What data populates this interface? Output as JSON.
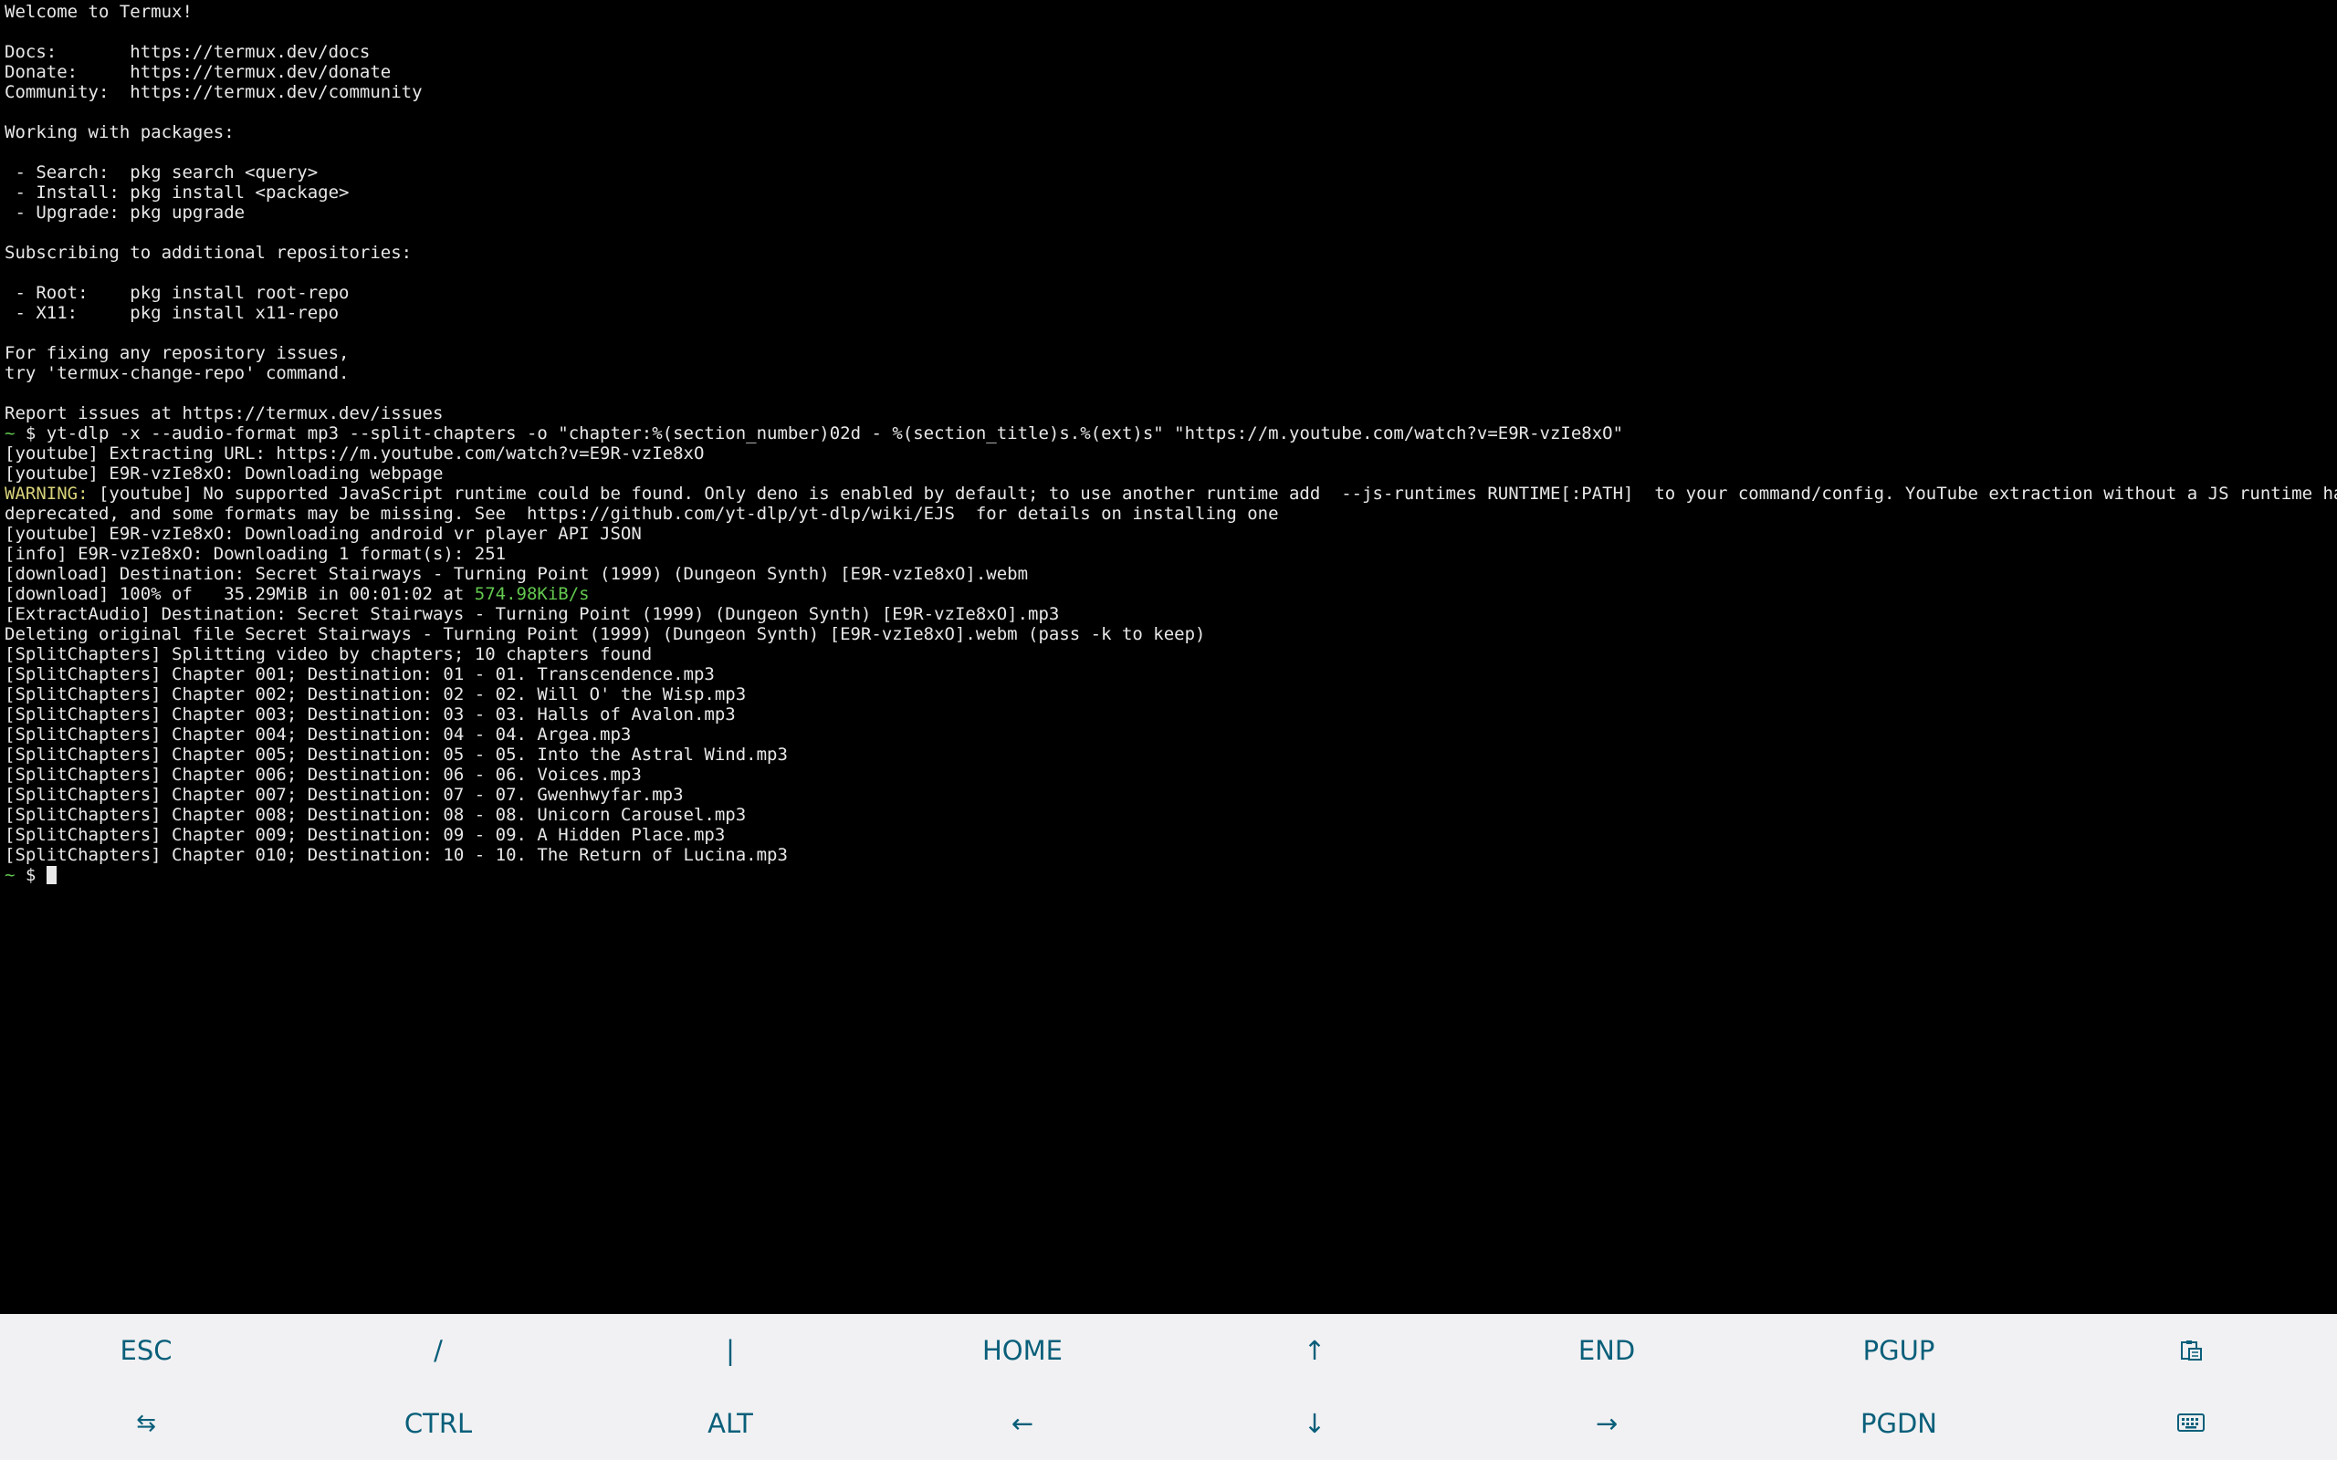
{
  "colors": {
    "background": "#000000",
    "text": "#e8e8e8",
    "prompt": "#63c94f",
    "warning": "#d8d37a",
    "speed": "#63c94f",
    "extra_keys_bg": "#f1f1f3",
    "extra_keys_text": "#0a5f7a"
  },
  "terminal": {
    "lines": [
      [
        {
          "t": "Welcome to Termux!"
        }
      ],
      [],
      [
        {
          "t": "Docs:       https://termux.dev/docs"
        }
      ],
      [
        {
          "t": "Donate:     https://termux.dev/donate"
        }
      ],
      [
        {
          "t": "Community:  https://termux.dev/community"
        }
      ],
      [],
      [
        {
          "t": "Working with packages:"
        }
      ],
      [],
      [
        {
          "t": " - Search:  pkg search <query>"
        }
      ],
      [
        {
          "t": " - Install: pkg install <package>"
        }
      ],
      [
        {
          "t": " - Upgrade: pkg upgrade"
        }
      ],
      [],
      [
        {
          "t": "Subscribing to additional repositories:"
        }
      ],
      [],
      [
        {
          "t": " - Root:    pkg install root-repo"
        }
      ],
      [
        {
          "t": " - X11:     pkg install x11-repo"
        }
      ],
      [],
      [
        {
          "t": "For fixing any repository issues,"
        }
      ],
      [
        {
          "t": "try 'termux-change-repo' command."
        }
      ],
      [],
      [
        {
          "t": "Report issues at https://termux.dev/issues"
        }
      ],
      [
        {
          "t": "~",
          "c": "green"
        },
        {
          "t": " $ yt-dlp -x --audio-format mp3 --split-chapters -o \"chapter:%(section_number)02d - %(section_title)s.%(ext)s\" \"https://m.youtube.com/watch?v=E9R-vzIe8xO\""
        }
      ],
      [
        {
          "t": "[youtube] Extracting URL: https://m.youtube.com/watch?v=E9R-vzIe8xO"
        }
      ],
      [
        {
          "t": "[youtube] E9R-vzIe8xO: Downloading webpage"
        }
      ],
      [
        {
          "t": "WARNING:",
          "c": "yellow"
        },
        {
          "t": " [youtube] No supported JavaScript runtime could be found. Only deno is enabled by default; to use another runtime add  --js-runtimes RUNTIME[:PATH]  to your command/config. YouTube extraction without a JS runtime has been"
        }
      ],
      [
        {
          "t": "deprecated, and some formats may be missing. See  https://github.com/yt-dlp/yt-dlp/wiki/EJS  for details on installing one"
        }
      ],
      [
        {
          "t": "[youtube] E9R-vzIe8xO: Downloading android vr player API JSON"
        }
      ],
      [
        {
          "t": "[info] E9R-vzIe8xO: Downloading 1 format(s): 251"
        }
      ],
      [
        {
          "t": "[download] Destination: Secret Stairways - Turning Point (1999) (Dungeon Synth) [E9R-vzIe8xO].webm"
        }
      ],
      [
        {
          "t": "[download] 100% of   35.29MiB in 00:01:02 at "
        },
        {
          "t": "574.98KiB/s",
          "c": "green"
        }
      ],
      [
        {
          "t": "[ExtractAudio] Destination: Secret Stairways - Turning Point (1999) (Dungeon Synth) [E9R-vzIe8xO].mp3"
        }
      ],
      [
        {
          "t": "Deleting original file Secret Stairways - Turning Point (1999) (Dungeon Synth) [E9R-vzIe8xO].webm (pass -k to keep)"
        }
      ],
      [
        {
          "t": "[SplitChapters] Splitting video by chapters; 10 chapters found"
        }
      ],
      [
        {
          "t": "[SplitChapters] Chapter 001; Destination: 01 - 01. Transcendence.mp3"
        }
      ],
      [
        {
          "t": "[SplitChapters] Chapter 002; Destination: 02 - 02. Will O' the Wisp.mp3"
        }
      ],
      [
        {
          "t": "[SplitChapters] Chapter 003; Destination: 03 - 03. Halls of Avalon.mp3"
        }
      ],
      [
        {
          "t": "[SplitChapters] Chapter 004; Destination: 04 - 04. Argea.mp3"
        }
      ],
      [
        {
          "t": "[SplitChapters] Chapter 005; Destination: 05 - 05. Into the Astral Wind.mp3"
        }
      ],
      [
        {
          "t": "[SplitChapters] Chapter 006; Destination: 06 - 06. Voices.mp3"
        }
      ],
      [
        {
          "t": "[SplitChapters] Chapter 007; Destination: 07 - 07. Gwenhwyfar.mp3"
        }
      ],
      [
        {
          "t": "[SplitChapters] Chapter 008; Destination: 08 - 08. Unicorn Carousel.mp3"
        }
      ],
      [
        {
          "t": "[SplitChapters] Chapter 009; Destination: 09 - 09. A Hidden Place.mp3"
        }
      ],
      [
        {
          "t": "[SplitChapters] Chapter 010; Destination: 10 - 10. The Return of Lucina.mp3"
        }
      ]
    ],
    "prompt": {
      "tilde": "~",
      "symbol": " $ "
    }
  },
  "extra_keys": {
    "row1": [
      {
        "label": "ESC",
        "name": "esc-key"
      },
      {
        "label": "/",
        "name": "slash-key"
      },
      {
        "label": "|",
        "name": "pipe-key"
      },
      {
        "label": "HOME",
        "name": "home-key"
      },
      {
        "label": "↑",
        "name": "up-arrow-key"
      },
      {
        "label": "END",
        "name": "end-key"
      },
      {
        "label": "PGUP",
        "name": "pgup-key"
      },
      {
        "label": "",
        "name": "paste-key",
        "icon": "clipboard-icon"
      }
    ],
    "row2": [
      {
        "label": "⇆",
        "name": "tab-key",
        "icon": "tab-icon"
      },
      {
        "label": "CTRL",
        "name": "ctrl-key"
      },
      {
        "label": "ALT",
        "name": "alt-key"
      },
      {
        "label": "←",
        "name": "left-arrow-key"
      },
      {
        "label": "↓",
        "name": "down-arrow-key"
      },
      {
        "label": "→",
        "name": "right-arrow-key"
      },
      {
        "label": "PGDN",
        "name": "pgdn-key"
      },
      {
        "label": "",
        "name": "keyboard-key",
        "icon": "keyboard-icon"
      }
    ]
  }
}
